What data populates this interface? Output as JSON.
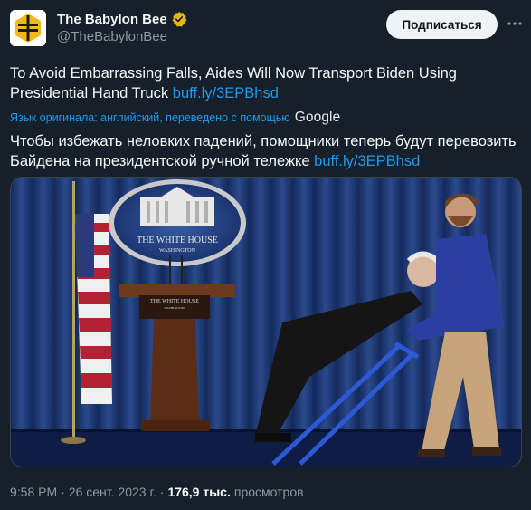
{
  "account": {
    "display_name": "The Babylon Bee",
    "handle": "@TheBabylonBee",
    "verified_badge_icon": "gold-verified-badge-icon",
    "avatar_icon": "bee-logo-icon"
  },
  "subscribe_label": "Подписаться",
  "more_icon": "more-horizontal-icon",
  "tweet": {
    "original_text": "To Avoid Embarrassing Falls, Aides Will Now Transport Biden Using Presidential Hand Truck",
    "original_link": "buff.ly/3EPBhsd",
    "translation_note": "Язык оригинала: английский, переведено с помощью",
    "translation_provider": "Google",
    "translated_text": "Чтобы избежать неловких падений, помощники теперь будут перевозить Байдена на президентской ручной тележке",
    "translated_link": "buff.ly/3EPBhsd"
  },
  "media": {
    "seal_text_1": "THE WHITE HOUSE",
    "seal_text_2": "WASHINGTON",
    "podium_text_1": "THE WHITE HOUSE",
    "podium_text_2": "WASHINGTON"
  },
  "meta": {
    "time": "9:58 PM",
    "separator": "·",
    "date": "26 сент. 2023 г.",
    "separator2": "·",
    "views": "176,9 тыс.",
    "views_label": "просмотров"
  },
  "colors": {
    "background": "#15202b",
    "link": "#1d9bf0",
    "secondary_text": "#8b98a5",
    "verified_gold": "#e2b719",
    "button_bg": "#eff3f4"
  }
}
